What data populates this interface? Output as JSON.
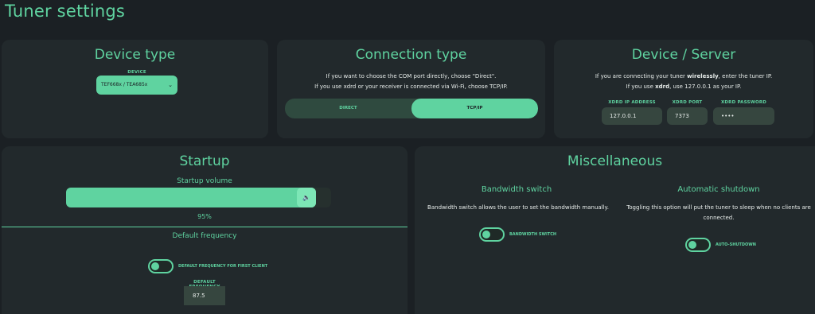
{
  "page": {
    "title": "Tuner settings"
  },
  "device_type": {
    "title": "Device type",
    "device_label": "DEVICE",
    "device_value": "TEF668x / TEA685x"
  },
  "connection_type": {
    "title": "Connection type",
    "desc_line1": "If you want to choose the COM port directly, choose \"Direct\".",
    "desc_line2": "If you use xdrd or your receiver is connected via Wi-Fi, choose TCP/IP.",
    "options": [
      "DIRECT",
      "TCP/IP"
    ],
    "selected": "TCP/IP"
  },
  "device_server": {
    "title": "Device / Server",
    "desc_line1_pre": "If you are connecting your tuner ",
    "desc_line1_bold": "wirelessly",
    "desc_line1_post": ", enter the tuner IP.",
    "desc_line2_pre": "If you use ",
    "desc_line2_bold": "xdrd",
    "desc_line2_post": ", use 127.0.0.1 as your IP.",
    "ip_label": "XDRD IP ADDRESS",
    "ip_value": "127.0.0.1",
    "port_label": "XDRD PORT",
    "port_value": "7373",
    "password_label": "XDRD PASSWORD",
    "password_value": "••••"
  },
  "startup": {
    "title": "Startup",
    "volume_label": "Startup volume",
    "volume_percent_text": "95%",
    "volume_fraction": 0.95,
    "volume_icon": "speaker-icon",
    "default_freq_title": "Default frequency",
    "toggle_label": "DEFAULT FREQUENCY FOR FIRST CLIENT",
    "freq_label": "DEFAULT FREQUENCY",
    "freq_value": "87.5"
  },
  "misc": {
    "title": "Miscellaneous",
    "bandwidth": {
      "title": "Bandwidth switch",
      "desc": "Bandwidth switch allows the user to set the bandwidth manually.",
      "toggle_label": "BANDWIDTH SWITCH"
    },
    "shutdown": {
      "title": "Automatic shutdown",
      "desc_line1": "Toggling this option will put the tuner to sleep when no clients are",
      "desc_line2": "connected.",
      "toggle_label": "AUTO-SHUTDOWN"
    }
  },
  "colors": {
    "accent": "#5fd3a0",
    "background": "#1b2024",
    "panel": "#22292c"
  }
}
